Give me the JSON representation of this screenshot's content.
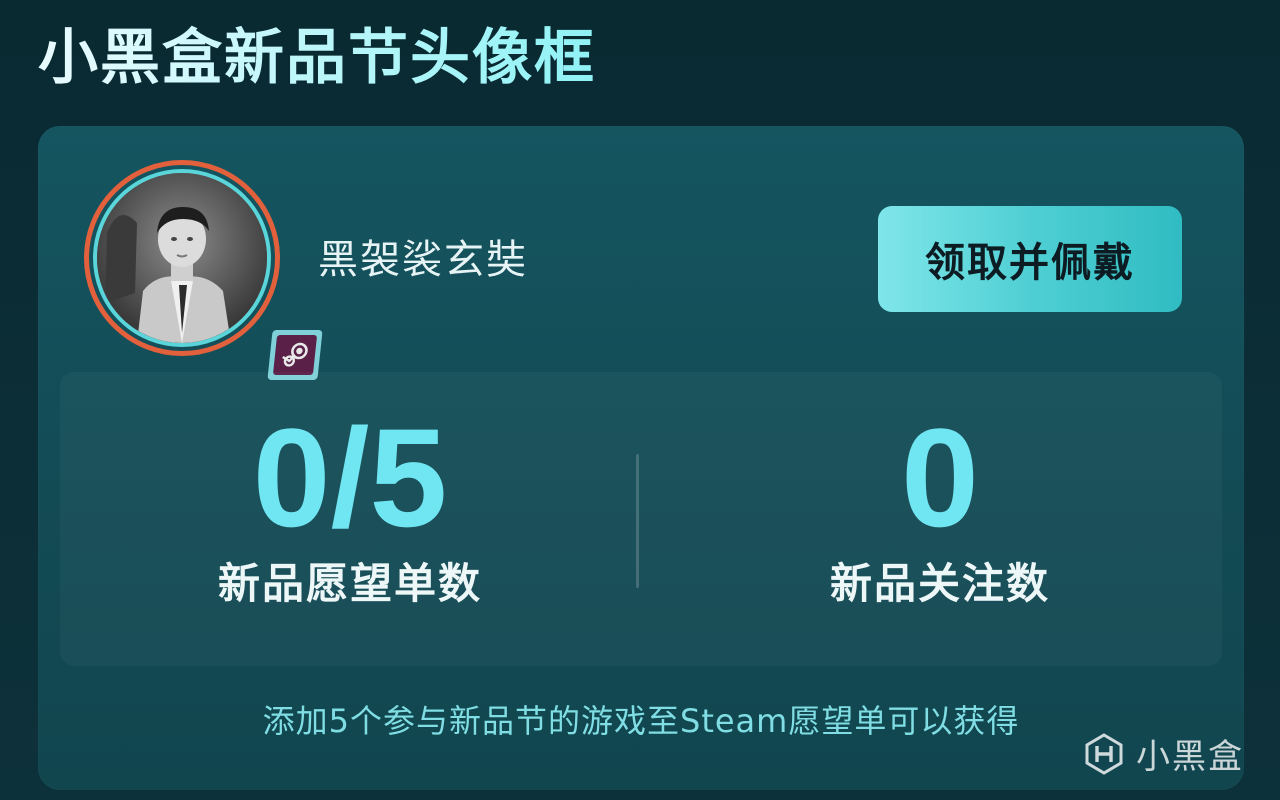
{
  "page": {
    "title": "小黑盒新品节头像框"
  },
  "profile": {
    "username": "黑袈裟玄奘",
    "avatar_icon": "user-photo",
    "badge_icon": "steam-icon"
  },
  "actions": {
    "claim_label": "领取并佩戴"
  },
  "stats": {
    "wishlist_value": "0/5",
    "wishlist_label": "新品愿望单数",
    "follow_value": "0",
    "follow_label": "新品关注数"
  },
  "hint": {
    "text": "添加5个参与新品节的游戏至Steam愿望单可以获得"
  },
  "watermark": {
    "text": "小黑盒",
    "logo_icon": "heybox-logo-icon"
  },
  "colors": {
    "accent": "#6fe6f2",
    "button_start": "#7fe6ea",
    "button_end": "#2fbcc2",
    "ring_outer": "#e2603b",
    "ring_inner": "#5ad6db"
  }
}
